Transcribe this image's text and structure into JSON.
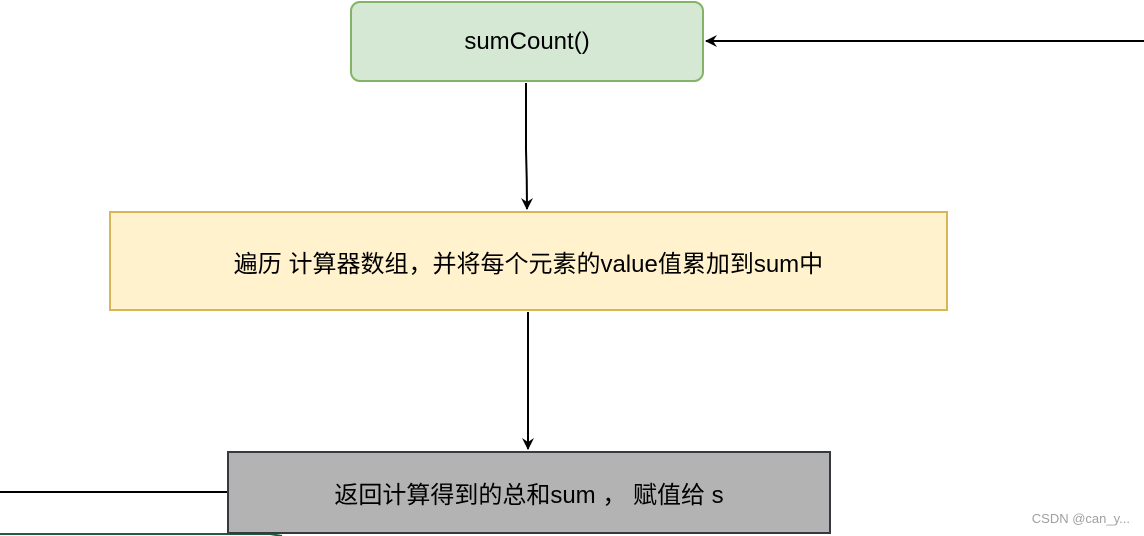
{
  "nodes": {
    "start": {
      "label": "sumCount()",
      "fill": "#d5e8d4",
      "border": "#82b366"
    },
    "process": {
      "label": "遍历 计算器数组，并将每个元素的value值累加到sum中",
      "fill": "#fff2cc",
      "border": "#d6b656"
    },
    "return": {
      "label": "返回计算得到的总和sum ， 赋值给 s",
      "fill": "#b3b3b3",
      "border": "#36393d"
    }
  },
  "watermark": "CSDN @can_y...",
  "colors": {
    "edge": "#000000"
  }
}
